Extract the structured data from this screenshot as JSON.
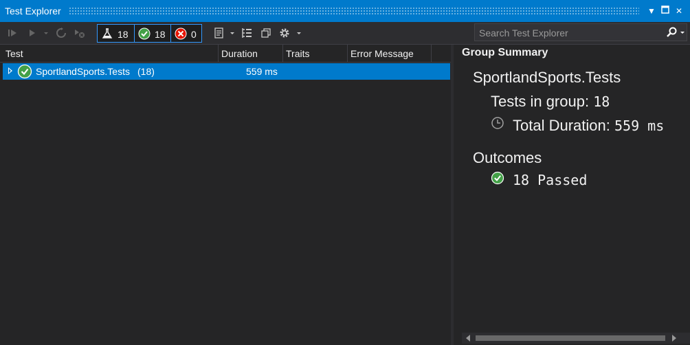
{
  "window": {
    "title": "Test Explorer"
  },
  "toolbar": {
    "total_count": "18",
    "passed_count": "18",
    "failed_count": "0",
    "search_placeholder": "Search Test Explorer"
  },
  "columns": [
    "Test",
    "Duration",
    "Traits",
    "Error Message"
  ],
  "tests": [
    {
      "name": "SportlandSports.Tests",
      "count": "(18)",
      "duration": "559 ms",
      "outcome": "passed"
    }
  ],
  "summary": {
    "heading": "Group Summary",
    "group_name": "SportlandSports.Tests",
    "tests_in_group_label": "Tests in group:",
    "tests_in_group_value": "18",
    "total_duration_label": "Total Duration:",
    "total_duration_value": "559 ms",
    "outcomes_heading": "Outcomes",
    "passed_text": "18 Passed"
  },
  "colors": {
    "accent": "#007acc",
    "pass": "#43a047",
    "fail": "#e51400",
    "background": "#252526"
  }
}
